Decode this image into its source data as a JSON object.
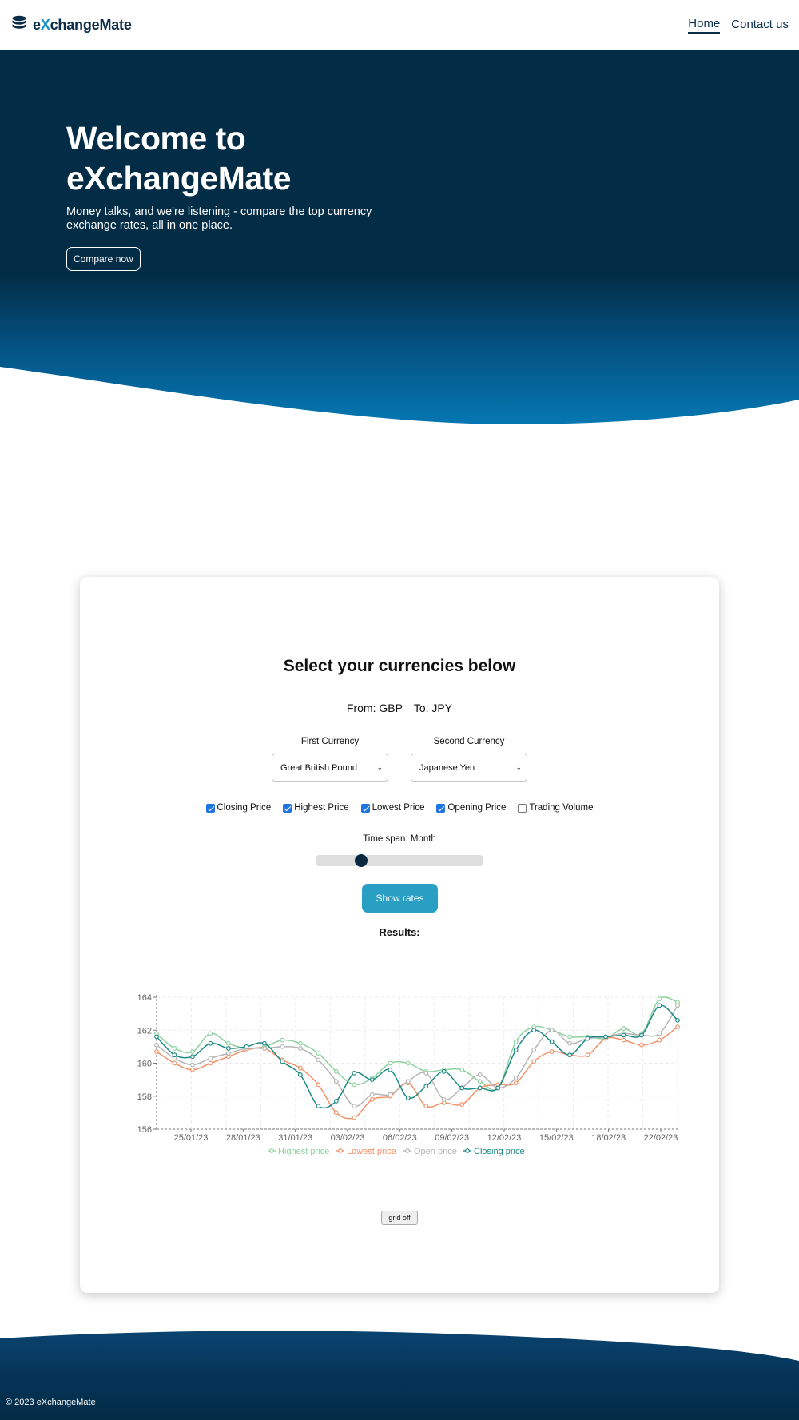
{
  "nav": {
    "brand_prefix": "e",
    "brand_x": "X",
    "brand_rest": "changeMate",
    "links": [
      {
        "label": "Home",
        "active": true
      },
      {
        "label": "Contact us",
        "active": false
      }
    ]
  },
  "hero": {
    "title_line1": "Welcome to",
    "title_line2": "eXchangeMate",
    "subtitle": "Money talks, and we're listening - compare the top currency exchange rates, all in one place.",
    "button_label": "Compare now"
  },
  "form": {
    "heading": "Select your currencies below",
    "from_text": "From: GBP",
    "to_text": "To: JPY",
    "first_label": "First Currency",
    "first_value": "Great British Pound",
    "second_label": "Second Currency",
    "second_value": "Japanese Yen",
    "checkboxes": [
      {
        "label": "Closing Price",
        "checked": true
      },
      {
        "label": "Highest Price",
        "checked": true
      },
      {
        "label": "Lowest Price",
        "checked": true
      },
      {
        "label": "Opening Price",
        "checked": true
      },
      {
        "label": "Trading Volume",
        "checked": false
      }
    ],
    "timespan_label": "Time span: Month",
    "slider_value": 0.27,
    "show_button": "Show rates",
    "results_label": "Results:",
    "grid_button": "grid off"
  },
  "chart_data": {
    "type": "line",
    "title": "",
    "xlabel": "",
    "ylabel": "",
    "ylim": [
      156,
      164
    ],
    "yticks": [
      "164",
      "162",
      "160",
      "158",
      "156"
    ],
    "x_tick_labels": [
      "25/01/23",
      "28/01/23",
      "31/01/23",
      "03/02/23",
      "06/02/23",
      "09/02/23",
      "12/02/23",
      "15/02/23",
      "18/02/23",
      "22/02/23"
    ],
    "grid": true,
    "legend_position": "bottom",
    "series": [
      {
        "name": "Highest price",
        "color": "#8fd1a0",
        "values": [
          161.8,
          160.9,
          160.7,
          161.8,
          161.2,
          160.9,
          161.0,
          161.4,
          161.2,
          160.6,
          159.5,
          158.7,
          159.1,
          160.0,
          160.0,
          159.5,
          159.6,
          159.6,
          158.9,
          158.5,
          161.3,
          162.2,
          162.0,
          161.6,
          161.6,
          161.5,
          162.1,
          161.8,
          163.9,
          163.7
        ]
      },
      {
        "name": "Lowest price",
        "color": "#f0936a",
        "values": [
          160.7,
          160.0,
          159.6,
          160.0,
          160.4,
          160.8,
          160.9,
          160.2,
          159.7,
          158.7,
          157.0,
          156.7,
          157.8,
          158.0,
          158.8,
          157.4,
          157.6,
          157.5,
          158.5,
          158.7,
          158.8,
          160.1,
          160.7,
          160.5,
          160.5,
          161.5,
          161.4,
          161.1,
          161.4,
          162.2
        ]
      },
      {
        "name": "Open price",
        "color": "#b5b5b5",
        "values": [
          161.1,
          160.3,
          159.9,
          160.3,
          160.6,
          160.9,
          160.9,
          161.0,
          160.9,
          160.2,
          158.9,
          157.4,
          158.1,
          158.1,
          158.9,
          159.4,
          157.8,
          158.5,
          159.3,
          158.5,
          159.1,
          160.8,
          162.0,
          161.2,
          161.5,
          161.6,
          161.8,
          161.7,
          161.8,
          163.5
        ]
      },
      {
        "name": "Closing price",
        "color": "#1e8a84",
        "values": [
          161.6,
          160.5,
          160.4,
          161.2,
          160.9,
          161.0,
          161.2,
          160.1,
          159.3,
          157.4,
          157.7,
          159.4,
          159.0,
          159.6,
          157.9,
          158.6,
          159.5,
          158.5,
          158.5,
          158.5,
          160.8,
          162.0,
          161.3,
          160.5,
          161.5,
          161.6,
          161.7,
          161.7,
          163.5,
          162.6
        ]
      }
    ]
  },
  "footer": {
    "text": "© 2023 eXchangeMate"
  }
}
